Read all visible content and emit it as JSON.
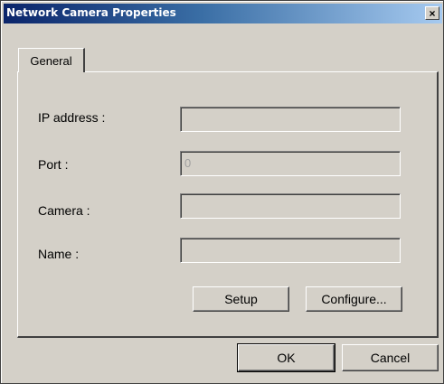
{
  "window": {
    "title": "Network Camera Properties",
    "close_glyph": "×"
  },
  "tabs": [
    {
      "label": "General",
      "selected": true
    }
  ],
  "fields": [
    {
      "label": "IP address :",
      "value": ""
    },
    {
      "label": "Port :",
      "value": "0"
    },
    {
      "label": "Camera :",
      "value": ""
    },
    {
      "label": "Name :",
      "value": ""
    }
  ],
  "panel_buttons": {
    "setup": "Setup",
    "configure": "Configure..."
  },
  "dialog_buttons": {
    "ok": "OK",
    "cancel": "Cancel"
  },
  "colors": {
    "titlebar_start": "#0a246a",
    "titlebar_end": "#a6caf0",
    "face": "#d4d0c8"
  }
}
